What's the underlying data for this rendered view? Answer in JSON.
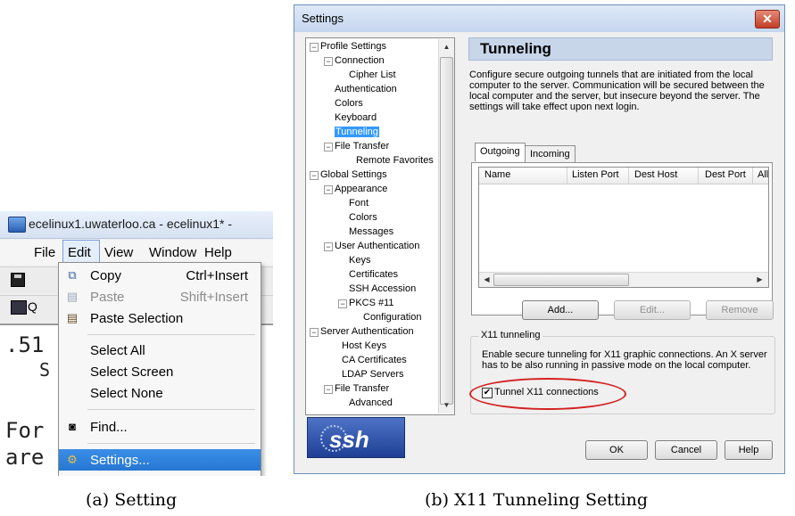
{
  "panel_a": {
    "window_title": "ecelinux1.uwaterloo.ca - ecelinux1* -",
    "menubar": {
      "file": "File",
      "edit": "Edit",
      "view": "View",
      "window": "Window",
      "help": "Help"
    },
    "toolbar_quick_label": "Q",
    "terminal_lines": [
      ".51",
      "S",
      "For",
      "are"
    ],
    "edit_menu": {
      "copy": {
        "label": "Copy",
        "shortcut": "Ctrl+Insert",
        "icon": "copy-icon"
      },
      "paste": {
        "label": "Paste",
        "shortcut": "Shift+Insert",
        "icon": "paste-icon",
        "enabled": false
      },
      "paste_selection": {
        "label": "Paste Selection",
        "icon": "paste-selection-icon"
      },
      "select_all": "Select All",
      "select_screen": "Select Screen",
      "select_none": "Select None",
      "find": {
        "label": "Find...",
        "icon": "binoculars-icon"
      },
      "settings": {
        "label": "Settings...",
        "icon": "settings-icon",
        "highlighted": true
      }
    },
    "caption": "(a) Setting"
  },
  "panel_b": {
    "dialog_title": "Settings",
    "close_glyph": "✕",
    "tree": {
      "profile_settings": "Profile Settings",
      "connection": "Connection",
      "cipher_list": "Cipher List",
      "authentication": "Authentication",
      "colors": "Colors",
      "keyboard": "Keyboard",
      "tunneling": "Tunneling",
      "file_transfer": "File Transfer",
      "remote_favorites": "Remote Favorites",
      "global_settings": "Global Settings",
      "appearance": "Appearance",
      "font": "Font",
      "colors_global": "Colors",
      "messages": "Messages",
      "user_authentication": "User Authentication",
      "keys": "Keys",
      "certificates": "Certificates",
      "ssh_accession": "SSH Accession",
      "pkcs11": "PKCS #11",
      "configuration": "Configuration",
      "server_authentication": "Server Authentication",
      "host_keys": "Host Keys",
      "ca_certificates": "CA Certificates",
      "ldap_servers": "LDAP Servers",
      "file_transfer_global": "File Transfer",
      "advanced": "Advanced"
    },
    "logo_text": "ssh",
    "section_title": "Tunneling",
    "description": "Configure secure outgoing tunnels that are initiated from the local computer to the server. Communication will be secured between the local computer and the server, but insecure beyond the server. The settings will take effect upon next login.",
    "tabs": {
      "outgoing": "Outgoing",
      "incoming": "Incoming",
      "active": "Outgoing"
    },
    "columns": [
      "Name",
      "Listen Port",
      "Dest Host",
      "Dest Port",
      "Allow"
    ],
    "buttons": {
      "add": "Add...",
      "edit": "Edit...",
      "remove": "Remove",
      "ok": "OK",
      "cancel": "Cancel",
      "help": "Help"
    },
    "x11": {
      "group_title": "X11 tunneling",
      "description": "Enable secure tunneling for X11 graphic connections. An X server has to be also running in passive mode on the local computer.",
      "checkbox_label": "Tunnel X11 connections",
      "checked": true,
      "check_glyph": "✔"
    },
    "caption": "(b) X11 Tunneling Setting"
  },
  "colors": {
    "selection": "#3399ff",
    "menu_highlight": "#2677d3",
    "annotation": "#d42020"
  }
}
